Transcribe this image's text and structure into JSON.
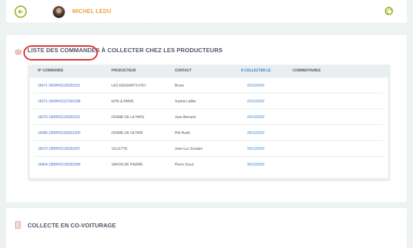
{
  "header": {
    "user_name": "MICHEL LEDU"
  },
  "orders_section": {
    "title": "LISTE DES COMMANDES À COLLECTER CHEZ LES PRODUCTEURS",
    "columns": {
      "order_no": "N° COMMANDE",
      "producer": "PRODUCTEUR",
      "contact": "CONTACT",
      "collect_by": "À COLLECTER LE",
      "comments": "COMMENTAIRES"
    },
    "rows": [
      {
        "order_no": "16371-1003P/21120201221",
        "producer": "LES DESSERTS D'ICI",
        "contact": "Bruno",
        "collect_by": "23/12/2020",
        "comments": ""
      },
      {
        "order_no": "16371-1003P/21127301238",
        "producer": "EPIS & PAINS",
        "contact": "Sophie Lafitte",
        "collect_by": "23/12/2020",
        "comments": ""
      },
      {
        "order_no": "16372-1355P/21120201221",
        "producer": "FERME DE LA HAYE",
        "contact": "Jean Bernard",
        "collect_by": "24/12/2020",
        "comments": ""
      },
      {
        "order_no": "16385-1355P/21100221200",
        "producer": "FERME DE VILTAIN",
        "contact": "Phil Rudd",
        "collect_by": "28/12/2020",
        "comments": ""
      },
      {
        "order_no": "16372-1355P/21120201267",
        "producer": "VILLETTE",
        "contact": "Jean-Luc Soudani",
        "collect_by": "29/12/2020",
        "comments": ""
      },
      {
        "order_no": "16304-1355P/21120201299",
        "producer": "SAVON DE PIERRE",
        "contact": "Pierre Grout",
        "collect_by": "30/12/2020",
        "comments": ""
      }
    ]
  },
  "carpool_section": {
    "title": "COLLECTE EN CO-VOITURAGE"
  },
  "colors": {
    "accent_green": "#9dbd35",
    "accent_orange": "#e6a33a",
    "link_blue": "#2e5fb8",
    "highlight_red": "#d42a2a"
  }
}
